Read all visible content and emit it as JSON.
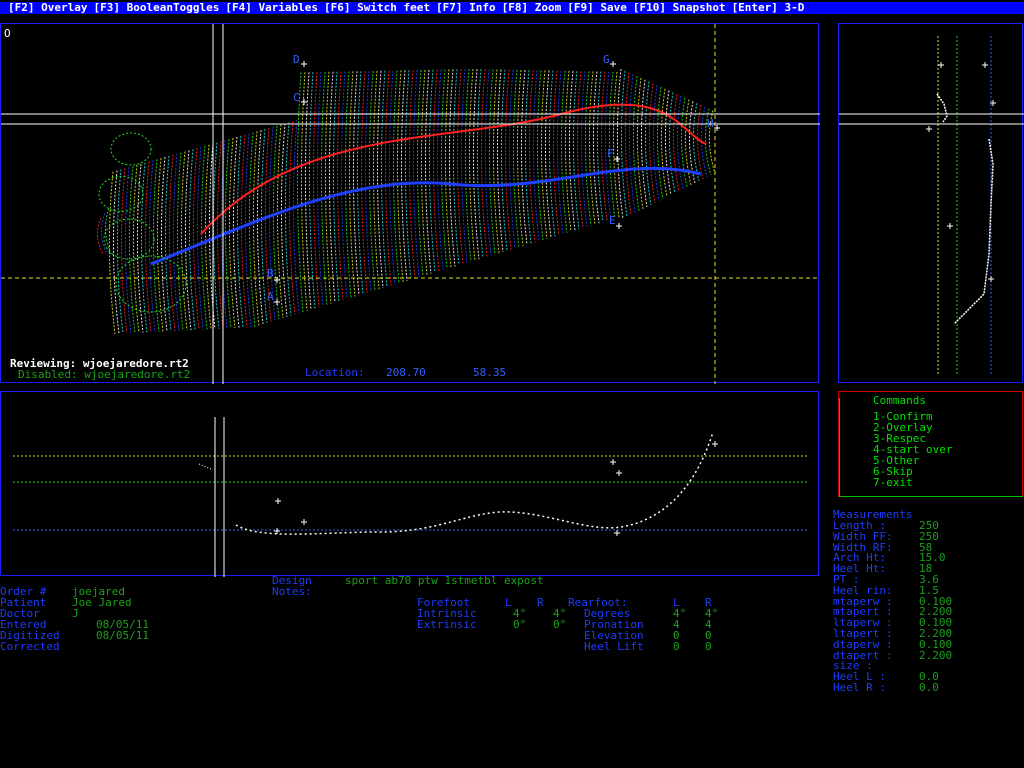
{
  "menu": [
    "[F2] Overlay",
    "[F3] BooleanToggles",
    "[F4] Variables",
    "[F6] Switch feet",
    "[F7] Info",
    "[F8] Zoom",
    "[F9] Save",
    "[F10] Snapshot",
    "[Enter] 3-D"
  ],
  "main_view": {
    "corner_label": "O",
    "reviewing": "Reviewing: wjoejaredore.rt2",
    "disabled": "Disabled: wjoejaredore.rt2",
    "location_label": "Location:",
    "location_x": "208.70",
    "location_y": "58.35",
    "point_labels": {
      "a": "A",
      "b": "B",
      "c": "C",
      "d": "D",
      "e": "E",
      "f": "F",
      "g": "G",
      "h": "H"
    }
  },
  "commands": {
    "title": "Commands",
    "items": [
      "1-Confirm",
      "2-Overlay",
      "3-Respec",
      "4-start over",
      "5-Other",
      "6-Skip",
      "7-exit"
    ]
  },
  "measurements": {
    "title": "Measurements",
    "rows": [
      {
        "label": "Length  :",
        "value": "250"
      },
      {
        "label": "Width FF:",
        "value": "250"
      },
      {
        "label": "Width RF:",
        "value": "58"
      },
      {
        "label": "Arch Ht:",
        "value": "15.0"
      },
      {
        "label": "Heel Ht:",
        "value": "18"
      },
      {
        "label": "PT     :",
        "value": "3.6"
      },
      {
        "label": "Heel rin:",
        "value": "1.5"
      },
      {
        "label": "mtaperw :",
        "value": "0.100"
      },
      {
        "label": "mtapert :",
        "value": "2.200"
      },
      {
        "label": "ltaperw :",
        "value": "0.100"
      },
      {
        "label": "ltapert :",
        "value": "2.200"
      },
      {
        "label": "dtaperw :",
        "value": "0.100"
      },
      {
        "label": "dtapert :",
        "value": "2.200"
      },
      {
        "label": "size   :",
        "value": ""
      },
      {
        "label": "Heel L :",
        "value": "0.0"
      },
      {
        "label": "Heel R :",
        "value": "0.0"
      }
    ]
  },
  "order": {
    "rows": [
      {
        "label": "Order #",
        "value": "joejared"
      },
      {
        "label": "Patient",
        "value": "Joe Jared"
      },
      {
        "label": "Doctor",
        "value": "J"
      },
      {
        "label": "Entered",
        "value": "08/05/11"
      },
      {
        "label": "Digitized",
        "value": "08/05/11"
      },
      {
        "label": "Corrected",
        "value": ""
      }
    ]
  },
  "design": {
    "label": "Design",
    "value": "sport ab70 ptw 1stmetbl expost",
    "notes_label": "Notes:"
  },
  "forefoot": {
    "header": "Forefoot",
    "col_l": "L",
    "col_r": "R",
    "rows": [
      {
        "label": "Intrinsic",
        "l": "4°",
        "r": "4°"
      },
      {
        "label": "Extrinsic",
        "l": "0°",
        "r": "0°"
      }
    ]
  },
  "rearfoot": {
    "header": "Rearfoot:",
    "col_l": "L",
    "col_r": "R",
    "rows": [
      {
        "label": "Degrees",
        "l": "4°",
        "r": "4°"
      },
      {
        "label": "Pronation",
        "l": "4",
        "r": "4"
      },
      {
        "label": "Elevation",
        "l": "0",
        "r": "0"
      },
      {
        "label": "Heel Lift",
        "l": "0",
        "r": "0"
      }
    ]
  },
  "colors": {
    "accent": "#0000ff",
    "label_blue": "#1e3cff",
    "value_green": "#1aa01a",
    "cmd_green": "#00e000",
    "cmd_border": "#d00000"
  }
}
